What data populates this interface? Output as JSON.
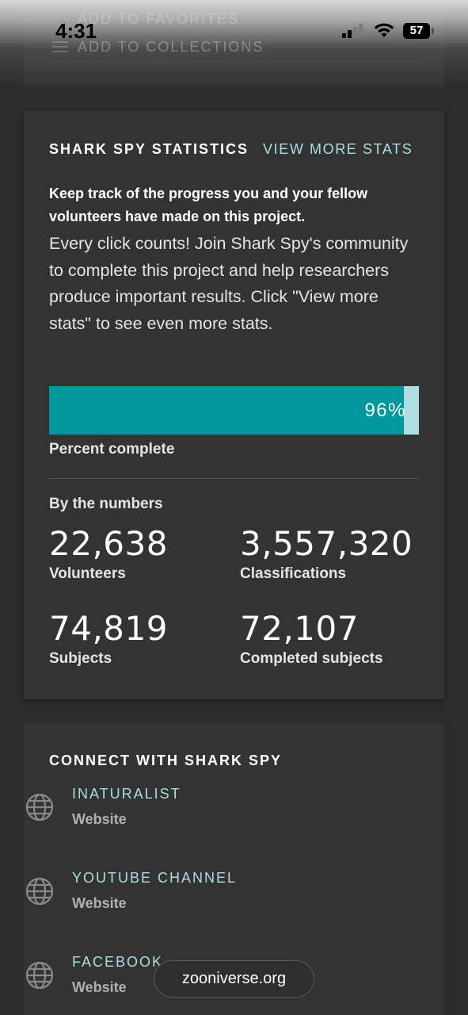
{
  "status_bar": {
    "time": "4:31",
    "battery": "57"
  },
  "top_card": {
    "favorites_label": "ADD TO FAVORITES",
    "collections_label": "ADD TO COLLECTIONS"
  },
  "stats": {
    "heading": "SHARK SPY STATISTICS",
    "view_more": "VIEW MORE STATS",
    "lead": "Keep track of the progress you and your fellow volunteers have made on this project.",
    "description": "Every click counts! Join Shark Spy's community to complete this project and help researchers produce important results. Click \"View more stats\" to see even more stats.",
    "progress_percent": 96,
    "progress_label": "96%",
    "percent_complete_label": "Percent complete",
    "numbers_heading": "By the numbers",
    "items": [
      {
        "value": "22,638",
        "label": "Volunteers"
      },
      {
        "value": "3,557,320",
        "label": "Classifications"
      },
      {
        "value": "74,819",
        "label": "Subjects"
      },
      {
        "value": "72,107",
        "label": "Completed subjects"
      }
    ]
  },
  "connect": {
    "heading": "CONNECT WITH SHARK SPY",
    "links": [
      {
        "name": "INATURALIST",
        "sub": "Website",
        "icon": "globe-icon"
      },
      {
        "name": "YOUTUBE CHANNEL",
        "sub": "Website",
        "icon": "globe-icon"
      },
      {
        "name": "FACEBOOK",
        "sub": "Website",
        "icon": "globe-icon"
      }
    ]
  },
  "browser": {
    "url": "zooniverse.org"
  },
  "colors": {
    "card_bg": "#333333",
    "page_bg": "#2b2b2b",
    "accent_teal": "#00979d",
    "light_teal": "#addde0"
  }
}
